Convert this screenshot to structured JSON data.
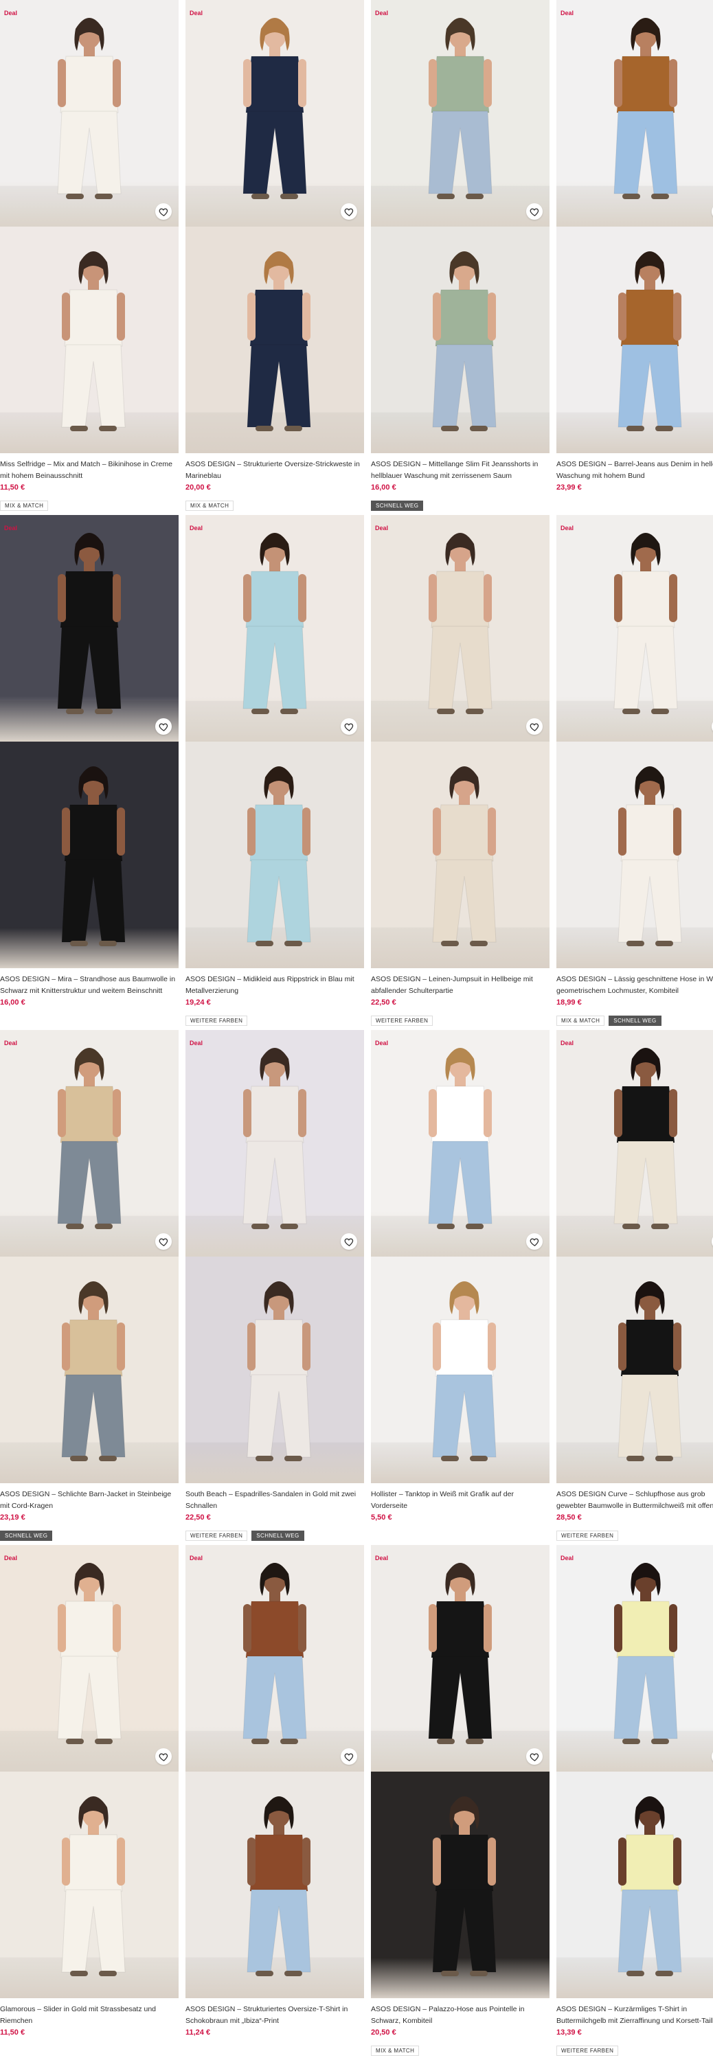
{
  "products": [
    {
      "title": "Miss Selfridge – Mix and Match – Bikinihose in Creme mit hohem Beinausschnitt",
      "price": "11,50 €",
      "deal": "Deal",
      "tags": [
        "MIX & MATCH"
      ],
      "bg1": "#f1efee",
      "bg2": "#efe9e6",
      "skin": "#c89478",
      "top": "#f5f1ea",
      "bottom": "#f5f1ea",
      "hair": "#3a2a22"
    },
    {
      "title": "ASOS DESIGN – Strukturierte Oversize-Strickweste in Marineblau",
      "price": "20,00 €",
      "deal": "Deal",
      "tags": [
        "MIX & MATCH"
      ],
      "bg1": "#f0ece8",
      "bg2": "#e8e0d8",
      "skin": "#e2b9a0",
      "top": "#1f2a44",
      "bottom": "#1f2a44",
      "hair": "#b07a45"
    },
    {
      "title": "ASOS DESIGN – Mittellange Slim Fit Jeansshorts in hellblauer Waschung mit zerrissenem Saum",
      "price": "16,00 €",
      "deal": "Deal",
      "tags": [
        "SCHNELL WEG"
      ],
      "bg1": "#ecebe6",
      "bg2": "#e8e6e2",
      "skin": "#d9a98c",
      "top": "#9fb39a",
      "bottom": "#a9bcd2",
      "hair": "#4a3828"
    },
    {
      "title": "ASOS DESIGN – Barrel-Jeans aus Denim in heller Waschung mit hohem Bund",
      "price": "23,99 €",
      "deal": "Deal",
      "tags": [],
      "bg1": "#f2f1f1",
      "bg2": "#f0eeee",
      "skin": "#b88060",
      "top": "#a6652c",
      "bottom": "#9ec0e2",
      "hair": "#2a1c14"
    },
    {
      "title": "ASOS DESIGN – Mira – Strandhose aus Baumwolle in Schwarz mit Knitterstruktur und weitem Beinschnitt",
      "price": "16,00 €",
      "deal": "Deal",
      "tags": [],
      "bg1": "#4a4a55",
      "bg2": "#2f2f36",
      "skin": "#8c5a40",
      "top": "#121212",
      "bottom": "#121212",
      "hair": "#1a1210"
    },
    {
      "title": "ASOS DESIGN – Midikleid aus Rippstrick in Blau mit Metallverzierung",
      "price": "19,24 €",
      "deal": "Deal",
      "tags": [
        "WEITERE FARBEN"
      ],
      "bg1": "#efe9e4",
      "bg2": "#e8e4e0",
      "skin": "#c49276",
      "top": "#aed4de",
      "bottom": "#aed4de",
      "hair": "#2a1c14"
    },
    {
      "title": "ASOS DESIGN – Leinen-Jumpsuit in Hellbeige mit abfallender Schulterpartie",
      "price": "22,50 €",
      "deal": "Deal",
      "tags": [
        "WEITERE FARBEN"
      ],
      "bg1": "#ece6df",
      "bg2": "#ebe4dc",
      "skin": "#d6a48a",
      "top": "#e7dccc",
      "bottom": "#e7dccc",
      "hair": "#3a2a22"
    },
    {
      "title": "ASOS DESIGN – Lässig geschnittene Hose in Weiß mit geometrischem Lochmuster, Kombiteil",
      "price": "18,99 €",
      "deal": "Deal",
      "tags": [
        "MIX & MATCH",
        "SCHNELL WEG"
      ],
      "bg1": "#f1efed",
      "bg2": "#efedeb",
      "skin": "#a06a4c",
      "top": "#f4efe8",
      "bottom": "#f4efe8",
      "hair": "#1f1712"
    },
    {
      "title": "ASOS DESIGN – Schlichte Barn-Jacket in Steinbeige mit Cord-Kragen",
      "price": "23,19 €",
      "deal": "Deal",
      "tags": [
        "SCHNELL WEG"
      ],
      "bg1": "#f0ede9",
      "bg2": "#ede7df",
      "skin": "#d09c7c",
      "top": "#d8c09a",
      "bottom": "#7e8a96",
      "hair": "#4a3828"
    },
    {
      "title": "South Beach – Espadrilles-Sandalen in Gold mit zwei Schnallen",
      "price": "22,50 €",
      "deal": "Deal",
      "tags": [
        "WEITERE FARBEN",
        "SCHNELL WEG"
      ],
      "bg1": "#e6e2e8",
      "bg2": "#dcd7dc",
      "skin": "#c8987c",
      "top": "#ede8e4",
      "bottom": "#ede8e4",
      "hair": "#3a2a22"
    },
    {
      "title": "Hollister – Tanktop in Weiß mit Grafik auf der Vorderseite",
      "price": "5,50 €",
      "deal": "Deal",
      "tags": [],
      "bg1": "#f3f1ef",
      "bg2": "#f2f0ee",
      "skin": "#e4b89e",
      "top": "#ffffff",
      "bottom": "#a9c4de",
      "hair": "#b58850"
    },
    {
      "title": "ASOS DESIGN Curve – Schlupfhose aus grob gewebter Baumwolle in Buttermilchweiß mit offenem…",
      "price": "28,50 €",
      "deal": "Deal",
      "tags": [
        "WEITERE FARBEN"
      ],
      "bg1": "#efece9",
      "bg2": "#eceae7",
      "skin": "#8a5a40",
      "top": "#141414",
      "bottom": "#ece4d6",
      "hair": "#1a1210"
    },
    {
      "title": "Glamorous – Slider in Gold mit Strassbesatz und Riemchen",
      "price": "11,50 €",
      "deal": "Deal",
      "tags": [],
      "bg1": "#efe6dc",
      "bg2": "#eee9e2",
      "skin": "#e0b090",
      "top": "#f6f2ea",
      "bottom": "#f6f2ea",
      "hair": "#3a2a22"
    },
    {
      "title": "ASOS DESIGN – Strukturiertes Oversize-T-Shirt in Schokobraun mit „Ibiza“-Print",
      "price": "11,24 €",
      "deal": "Deal",
      "tags": [],
      "bg1": "#efebe7",
      "bg2": "#ece8e4",
      "skin": "#8a5a40",
      "top": "#8c4a2a",
      "bottom": "#a9c4de",
      "hair": "#1f1712"
    },
    {
      "title": "ASOS DESIGN – Palazzo-Hose aus Pointelle in Schwarz, Kombiteil",
      "price": "20,50 €",
      "deal": "Deal",
      "tags": [
        "MIX & MATCH"
      ],
      "bg1": "#efece9",
      "bg2": "#2a2726",
      "skin": "#d09c7c",
      "top": "#151515",
      "bottom": "#151515",
      "hair": "#3a2a22"
    },
    {
      "title": "ASOS DESIGN – Kurzärmliges T-Shirt in Buttermilchgelb mit Zierraffinung und Korsett-Taille",
      "price": "13,39 €",
      "deal": "Deal",
      "tags": [
        "WEITERE FARBEN"
      ],
      "bg1": "#f2f2f2",
      "bg2": "#eeeeee",
      "skin": "#6a402c",
      "top": "#f1eeb4",
      "bottom": "#a9c4de",
      "hair": "#1a1210"
    }
  ]
}
